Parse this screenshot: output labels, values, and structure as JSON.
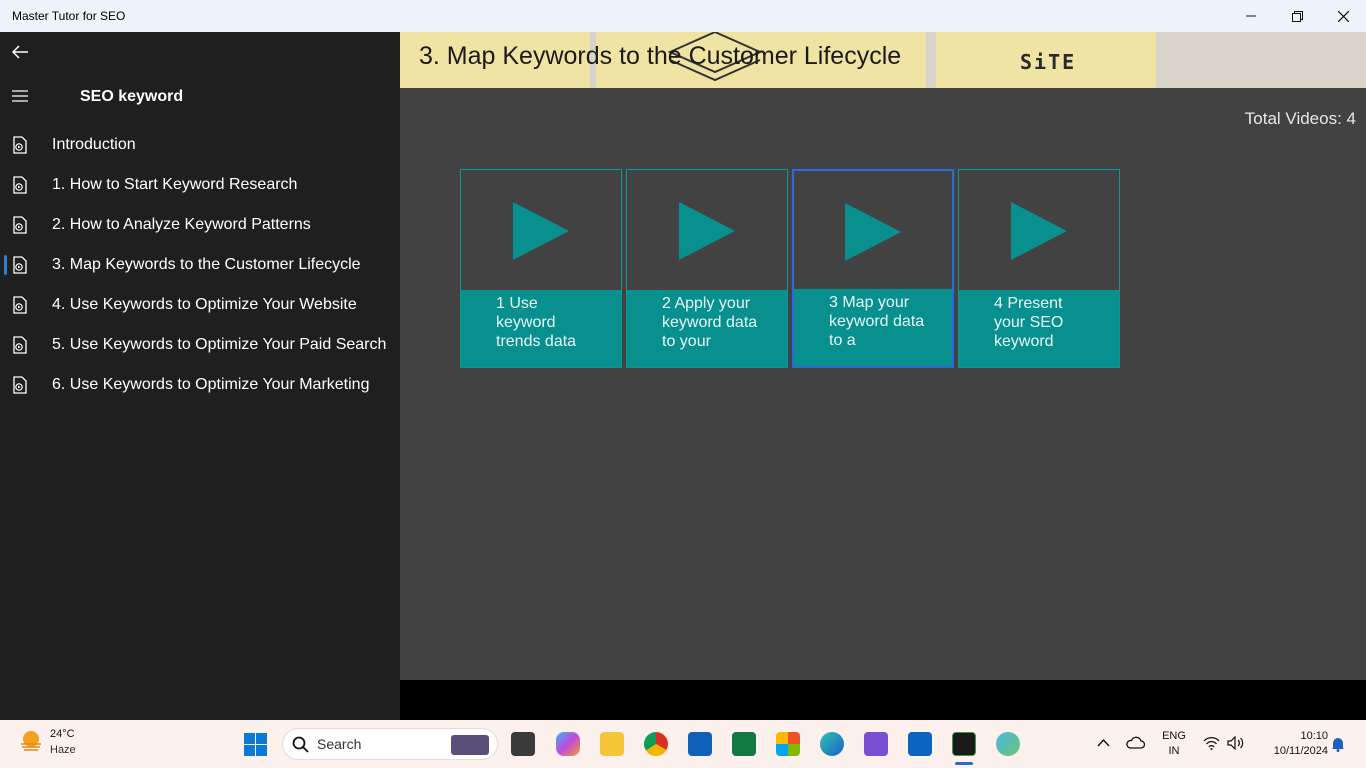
{
  "window": {
    "title": "Master Tutor for SEO",
    "controls": [
      "minimize-icon",
      "maximize-icon",
      "close-icon"
    ]
  },
  "sidebar": {
    "title": "SEO keyword",
    "items": [
      {
        "label": "Introduction",
        "selected": false
      },
      {
        "label": "1. How to Start Keyword Research",
        "selected": false
      },
      {
        "label": "2. How to Analyze Keyword Patterns",
        "selected": false
      },
      {
        "label": "3. Map Keywords to the Customer Lifecycle",
        "selected": true
      },
      {
        "label": "4. Use Keywords to Optimize Your Website",
        "selected": false
      },
      {
        "label": "5. Use Keywords to Optimize Your Paid Search",
        "selected": false
      },
      {
        "label": "6. Use Keywords to Optimize Your Marketing",
        "selected": false
      }
    ]
  },
  "main": {
    "page_title": "3. Map Keywords to the Customer Lifecycle",
    "banner_text": "SiTE",
    "total_videos_label": "Total Videos: 4",
    "videos": [
      {
        "lines": [
          "1  Use",
          "keyword",
          "trends data"
        ],
        "selected": false
      },
      {
        "lines": [
          "2  Apply your",
          "keyword data",
          "to your"
        ],
        "selected": false
      },
      {
        "lines": [
          "3  Map your",
          "keyword data",
          "to a"
        ],
        "selected": true
      },
      {
        "lines": [
          "4  Present",
          "your SEO",
          "keyword"
        ],
        "selected": false
      }
    ]
  },
  "taskbar": {
    "weather_temp": "24°C",
    "weather_cond": "Haze",
    "search_placeholder": "Search",
    "lang_top": "ENG",
    "lang_bottom": "IN",
    "time": "10:10",
    "date": "10/11/2024"
  },
  "colors": {
    "accent_teal": "#07908e",
    "selection_blue": "#2a6bd6",
    "sidebar_bg": "#1f1f1f",
    "main_bg": "#424242"
  }
}
